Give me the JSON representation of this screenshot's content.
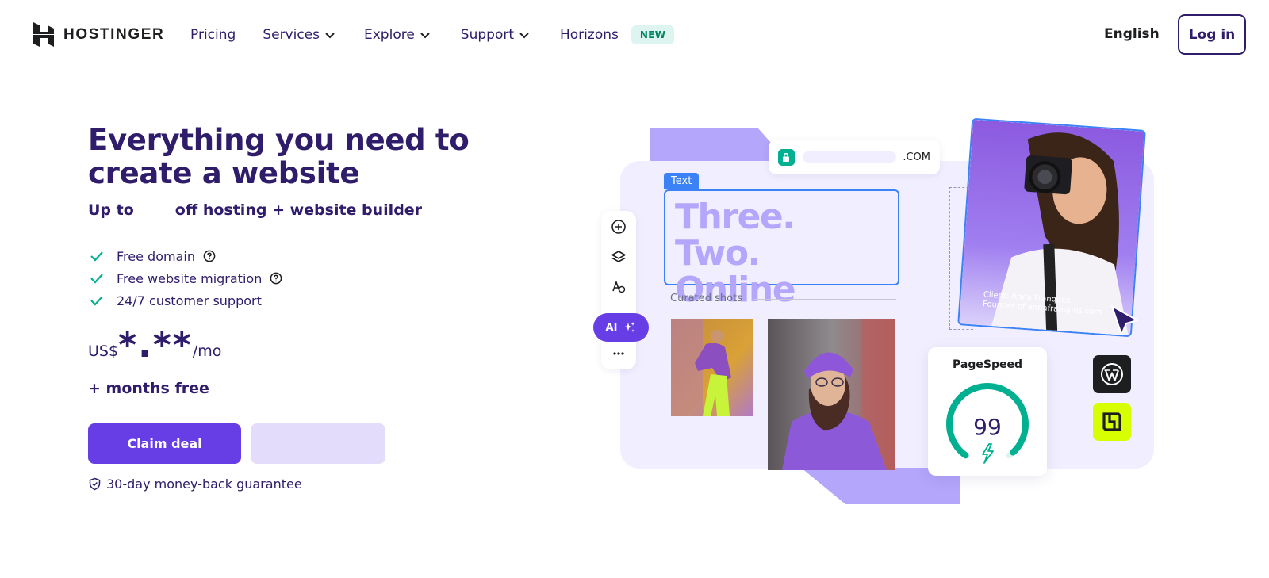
{
  "nav": {
    "logo_text": "HOSTINGER",
    "links": [
      {
        "label": "Pricing",
        "has_dropdown": false
      },
      {
        "label": "Services",
        "has_dropdown": true
      },
      {
        "label": "Explore",
        "has_dropdown": true
      },
      {
        "label": "Support",
        "has_dropdown": true
      },
      {
        "label": "Horizons",
        "has_dropdown": false
      }
    ],
    "badge": "NEW",
    "language": "English",
    "login": "Log in"
  },
  "hero": {
    "title": "Everything you need to create a website",
    "subtitle_prefix": "Up to",
    "subtitle_suffix": "off hosting + website builder",
    "features": [
      {
        "text": "Free domain",
        "help": true
      },
      {
        "text": "Free website migration",
        "help": true
      },
      {
        "text": "24/7 customer support",
        "help": false
      }
    ],
    "price": {
      "currency": "US$",
      "amount": "*.**",
      "period": "/mo"
    },
    "months_free": "+ months free",
    "cta": "Claim deal",
    "guarantee": "30-day money-back guarantee"
  },
  "illustration": {
    "url_tld": ".COM",
    "text_tag": "Text",
    "headline_line1": "Three. Two.",
    "headline_line2": "Online",
    "curated": "Curated shots",
    "ai_label": "AI",
    "client_line1": "Client: Anna Franques",
    "client_line2": "Founder of annafranques.com",
    "pagespeed_title": "PageSpeed",
    "pagespeed_value": "99",
    "pagespeed_score": 99
  },
  "colors": {
    "brand_purple": "#673de6",
    "dark_purple": "#2f1c6a",
    "light_purple": "#b3a6fb",
    "teal": "#00b090",
    "lime": "#d8ff00"
  }
}
